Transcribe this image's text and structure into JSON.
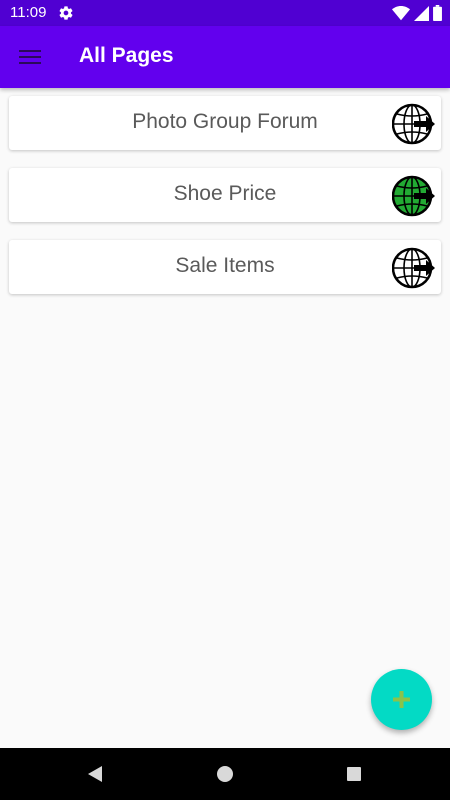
{
  "status_bar": {
    "time": "11:09",
    "icons": [
      "gear-icon",
      "wifi-icon",
      "cellular-signal-icon",
      "battery-icon"
    ]
  },
  "app_bar": {
    "title": "All Pages",
    "menu_icon": "hamburger-menu-icon",
    "color": "#6200ee"
  },
  "pages": [
    {
      "label": "Photo Group Forum",
      "icon": "globe-arrow-icon",
      "icon_fill": "#ffffff"
    },
    {
      "label": "Shoe Price",
      "icon": "globe-arrow-icon",
      "icon_fill": "#22aa33"
    },
    {
      "label": "Sale Items",
      "icon": "globe-arrow-icon",
      "icon_fill": "#ffffff"
    }
  ],
  "fab": {
    "icon": "plus-icon",
    "color": "#03dac5",
    "icon_color": "#8bc34a"
  },
  "nav_bar": {
    "icons": [
      "back-icon",
      "home-icon",
      "recent-apps-icon"
    ]
  }
}
